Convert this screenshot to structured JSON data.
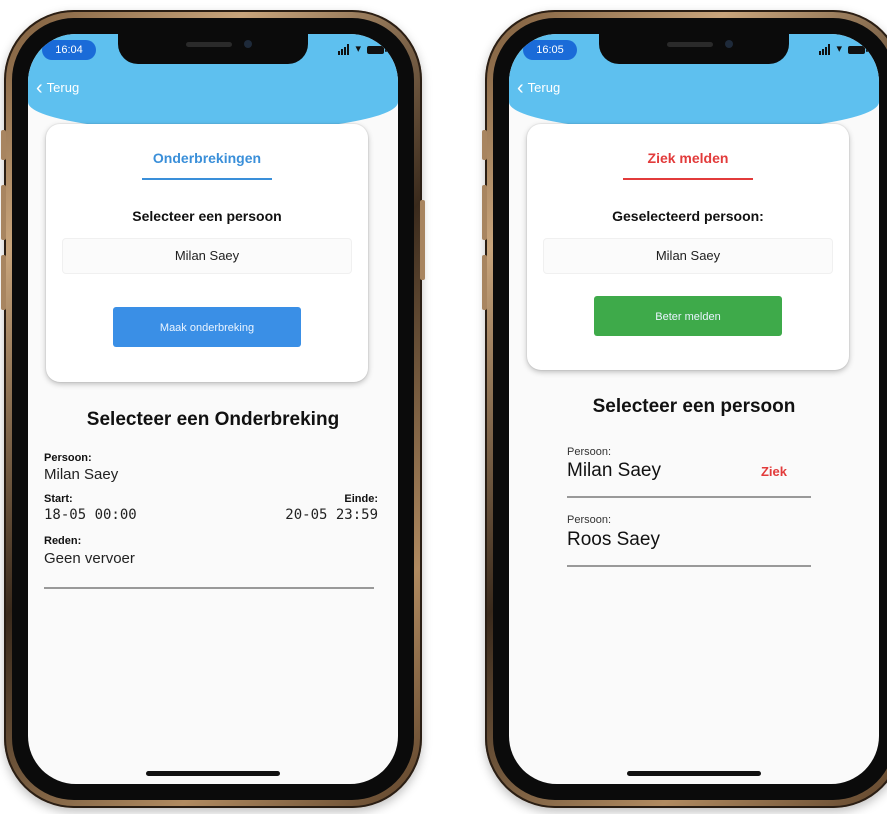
{
  "phones": [
    {
      "time": "16:04",
      "back_label": "Terug",
      "card": {
        "title": "Onderbrekingen",
        "title_color": "#3a8fd9",
        "subtitle": "Selecteer een persoon",
        "selected_name": "Milan Saey",
        "button_label": "Maak onderbreking",
        "button_color": "#3a8fe6"
      },
      "section_title": "Selecteer een Onderbreking",
      "interruption": {
        "person_label": "Persoon:",
        "person_value": "Milan Saey",
        "start_label": "Start:",
        "start_value": "18-05 00:00",
        "end_label": "Einde:",
        "end_value": "20-05 23:59",
        "reason_label": "Reden:",
        "reason_value": "Geen vervoer"
      }
    },
    {
      "time": "16:05",
      "back_label": "Terug",
      "card": {
        "title": "Ziek melden",
        "title_color": "#e23b3b",
        "subtitle": "Geselecteerd persoon:",
        "selected_name": "Milan Saey",
        "button_label": "Beter melden",
        "button_color": "#3eaa4a"
      },
      "section_title": "Selecteer een persoon",
      "persons": [
        {
          "label": "Persoon:",
          "name": "Milan Saey",
          "status": "Ziek",
          "status_color": "#e23b3b"
        },
        {
          "label": "Persoon:",
          "name": "Roos Saey",
          "status": ""
        }
      ]
    }
  ],
  "colors": {
    "header_blue": "#5ec0ef"
  }
}
